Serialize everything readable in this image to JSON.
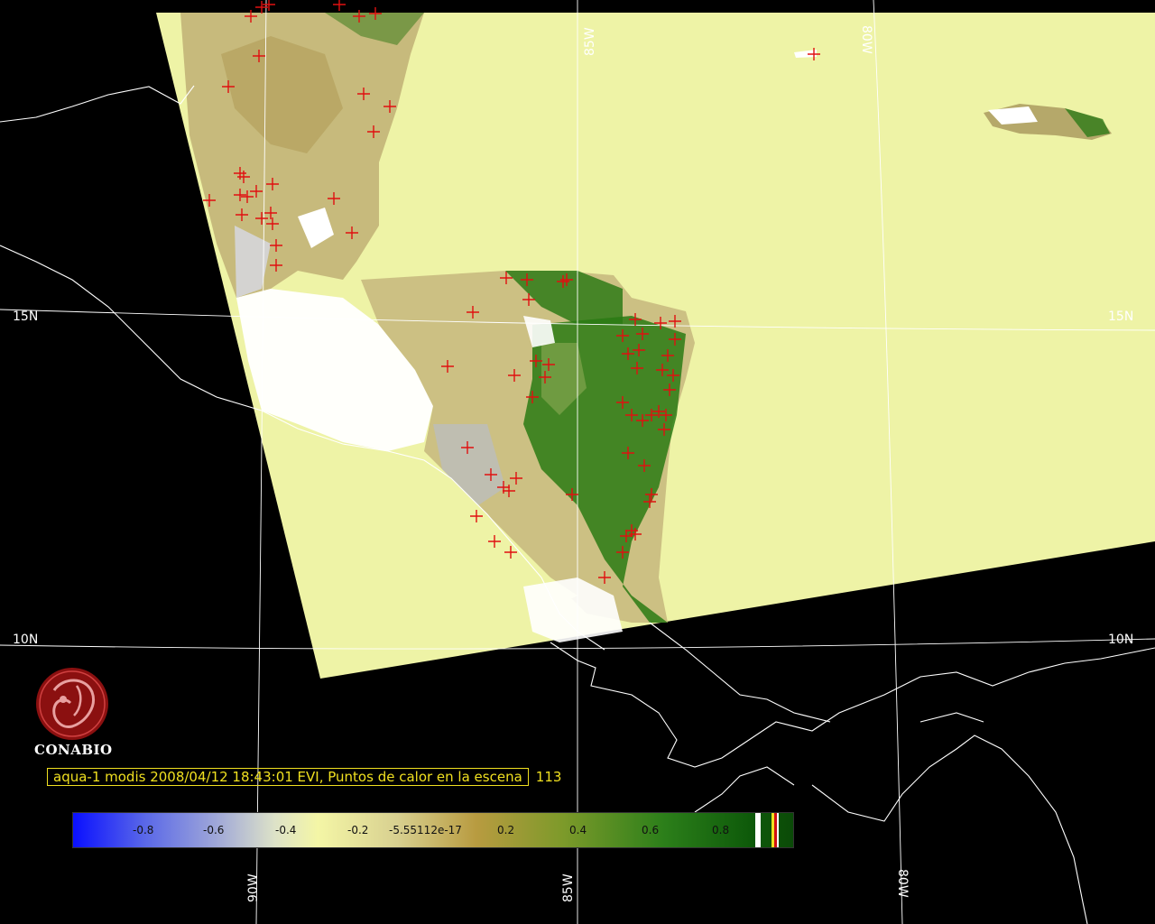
{
  "map": {
    "latitude_labels": [
      "15N",
      "10N"
    ],
    "longitude_labels": [
      "90W",
      "85W",
      "80W"
    ],
    "fire_point_icon": "red-cross-marker",
    "colors": {
      "swath_background": "#eef3a6",
      "land_brown": "#b8a860",
      "forest_green": "#1f6b10",
      "cloud_white": "#ffffff",
      "fire_red": "#e01010",
      "coastline": "#ffffff"
    }
  },
  "branding": {
    "logo_icon": "conabio-emblem-icon",
    "name": "CONABIO"
  },
  "caption": {
    "text": "aqua-1 modis 2008/04/12 18:43:01 EVI, Puntos de calor en la escena",
    "fire_count": "113"
  },
  "colorbar": {
    "ticks": [
      "-0.8",
      "-0.6",
      "-0.4",
      "-0.2",
      "-5.55112e-17",
      "0.2",
      "0.4",
      "0.6",
      "0.8"
    ],
    "range": [
      -1,
      1
    ]
  }
}
